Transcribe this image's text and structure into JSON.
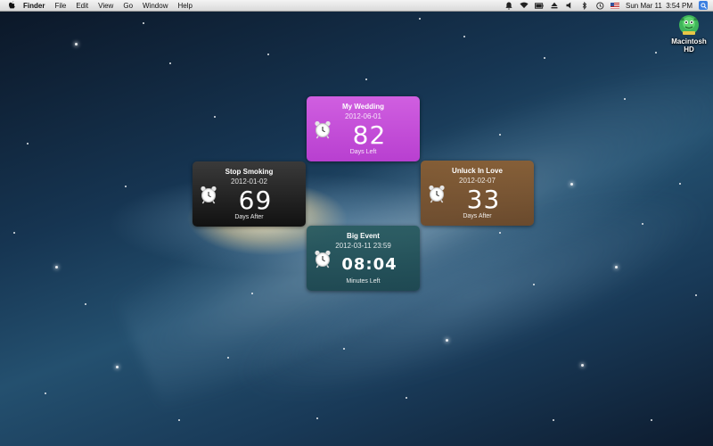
{
  "menubar": {
    "app_name": "Finder",
    "menus": [
      "File",
      "Edit",
      "View",
      "Go",
      "Window",
      "Help"
    ],
    "clock": "Sun Mar 11  3:54 PM"
  },
  "desktop": {
    "drive_label_line1": "Macintosh",
    "drive_label_line2": "HD"
  },
  "widgets": {
    "wedding": {
      "title": "My Wedding",
      "date": "2012-06-01",
      "value": "82",
      "caption": "Days Left",
      "color": "#c94fdc"
    },
    "smoking": {
      "title": "Stop Smoking",
      "date": "2012-01-02",
      "value": "69",
      "caption": "Days After",
      "color": "#222222"
    },
    "love": {
      "title": "Unluck In Love",
      "date": "2012-02-07",
      "value": "33",
      "caption": "Days After",
      "color": "#7d552e"
    },
    "event": {
      "title": "Big Event",
      "date": "2012-03-11 23:59",
      "value": "08:04",
      "caption": "Minutes Left",
      "color": "#24555c"
    }
  },
  "icons": {
    "menubar": [
      "apple-icon",
      "notification-icon",
      "wifi-icon",
      "battery-icon",
      "eject-icon",
      "volume-icon",
      "bluetooth-icon",
      "time-machine-icon",
      "us-flag-icon",
      "spotlight-icon"
    ],
    "widget": "alarm-clock-icon",
    "drive": "macintosh-hd-icon"
  }
}
